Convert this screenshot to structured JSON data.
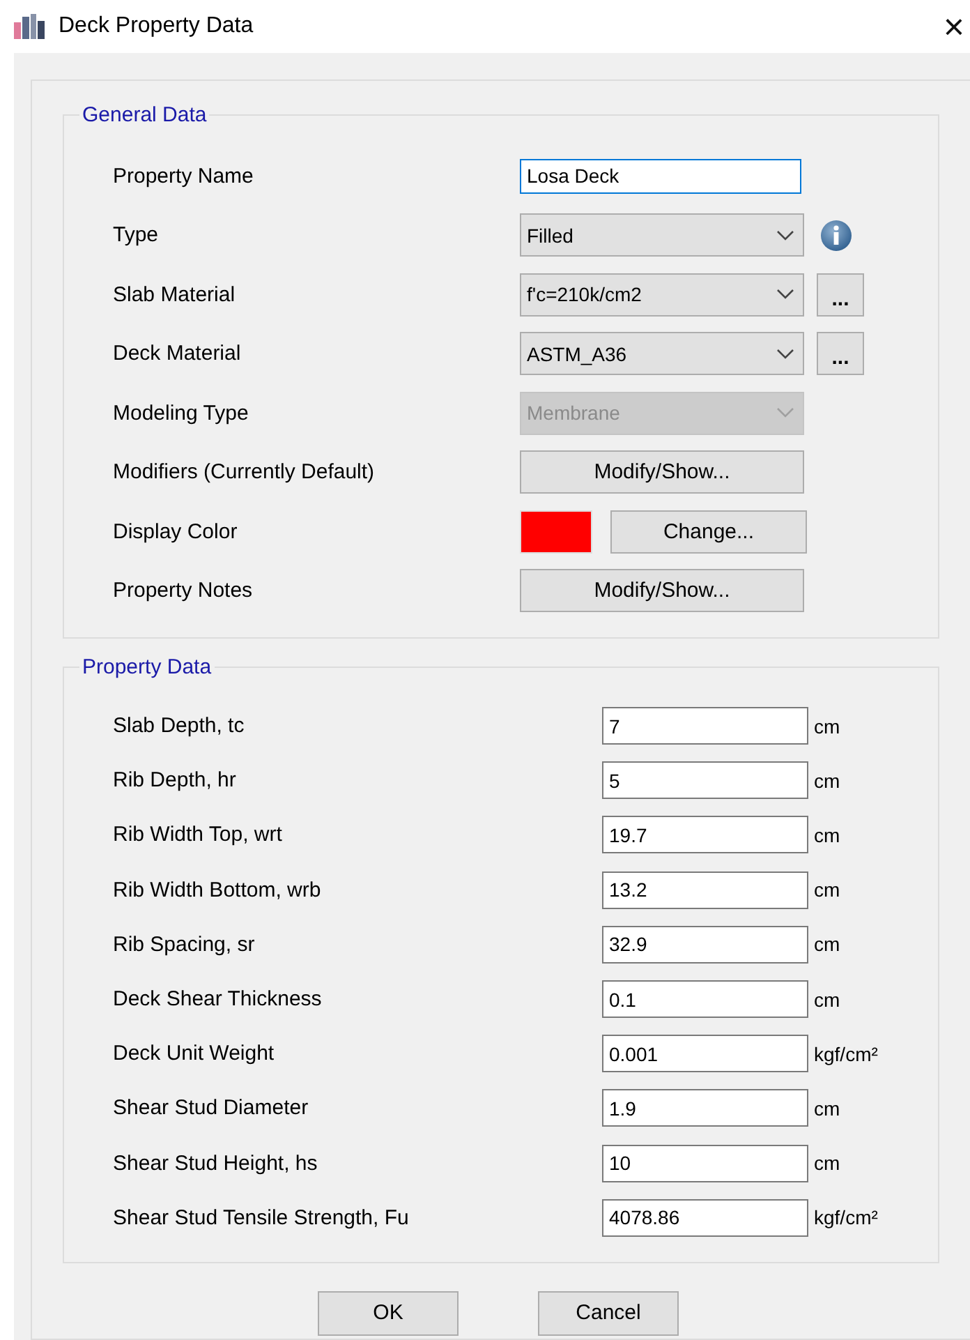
{
  "window": {
    "title": "Deck Property Data",
    "close": "×"
  },
  "general": {
    "legend": "General Data",
    "rows": [
      {
        "kind": "text",
        "label": "Property Name",
        "value": "Losa Deck",
        "focused": true
      },
      {
        "kind": "select",
        "label": "Type",
        "value": "Filled",
        "disabled": false,
        "info_icon": true
      },
      {
        "kind": "select",
        "label": "Slab Material",
        "value": "f'c=210k/cm2",
        "disabled": false,
        "browse_button": "..."
      },
      {
        "kind": "select",
        "label": "Deck Material",
        "value": "ASTM_A36",
        "disabled": false,
        "browse_button": "..."
      },
      {
        "kind": "select",
        "label": "Modeling Type",
        "value": "Membrane",
        "disabled": true
      },
      {
        "kind": "button",
        "label": "Modifiers (Currently Default)",
        "button": "Modify/Show..."
      },
      {
        "kind": "color",
        "label": "Display Color",
        "color": "#ff0000",
        "button": "Change..."
      },
      {
        "kind": "button",
        "label": "Property Notes",
        "button": "Modify/Show..."
      }
    ]
  },
  "property": {
    "legend": "Property Data",
    "rows": [
      {
        "label": "Slab Depth, tc",
        "value": "7",
        "unit": "cm"
      },
      {
        "label": "Rib Depth, hr",
        "value": "5",
        "unit": "cm"
      },
      {
        "label": "Rib Width Top, wrt",
        "value": "19.7",
        "unit": "cm"
      },
      {
        "label": "Rib Width Bottom, wrb",
        "value": "13.2",
        "unit": "cm"
      },
      {
        "label": "Rib Spacing, sr",
        "value": "32.9",
        "unit": "cm"
      },
      {
        "label": "Deck Shear Thickness",
        "value": "0.1",
        "unit": "cm"
      },
      {
        "label": "Deck Unit Weight",
        "value": "0.001",
        "unit": "kgf/cm²"
      },
      {
        "label": "Shear Stud Diameter",
        "value": "1.9",
        "unit": "cm"
      },
      {
        "label": "Shear Stud Height, hs",
        "value": "10",
        "unit": "cm"
      },
      {
        "label": "Shear Stud Tensile Strength, Fu",
        "value": "4078.86",
        "unit": "kgf/cm²"
      }
    ]
  },
  "buttons": [
    "OK",
    "Cancel"
  ]
}
